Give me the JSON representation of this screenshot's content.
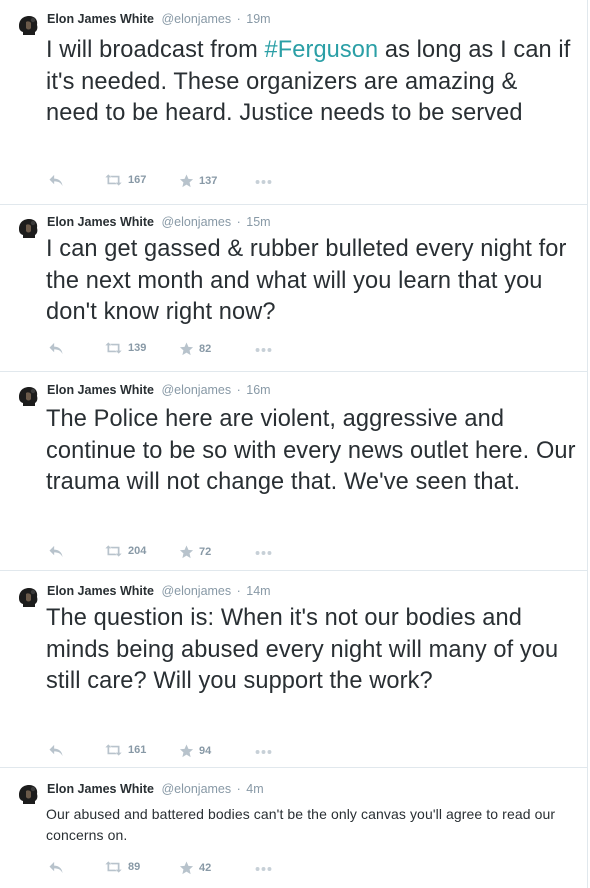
{
  "tweets": [
    {
      "name": "Elon James White",
      "handle": "@elonjames",
      "sep": "·",
      "time": "19m",
      "text_before": "I will broadcast from ",
      "hashtag": "#Ferguson",
      "text_after": " as long as I can if it's needed. These organizers are amazing & need to be heard. Justice needs to be served",
      "retweets": "167",
      "favorites": "137"
    },
    {
      "name": "Elon James White",
      "handle": "@elonjames",
      "sep": "·",
      "time": "15m",
      "text": "I can get gassed  & rubber bulleted every night for the next month and what will you learn that you don't know right now?",
      "retweets": "139",
      "favorites": "82"
    },
    {
      "name": "Elon James White",
      "handle": "@elonjames",
      "sep": "·",
      "time": "16m",
      "text": "The Police here are violent, aggressive and continue to be so with every news outlet here. Our trauma will not change that. We've seen that.",
      "retweets": "204",
      "favorites": "72"
    },
    {
      "name": "Elon James White",
      "handle": "@elonjames",
      "sep": "·",
      "time": "14m",
      "text": "The question is: When it's not our bodies and minds being abused every night will many of you still care? Will you support the work?",
      "retweets": "161",
      "favorites": "94"
    },
    {
      "name": "Elon James White",
      "handle": "@elonjames",
      "sep": "·",
      "time": "4m",
      "text": "Our abused and battered bodies can't be the only canvas you'll agree to read our concerns on.",
      "retweets": "89",
      "favorites": "42"
    }
  ],
  "icons": {
    "reply": "reply-icon",
    "retweet": "retweet-icon",
    "favorite": "star-icon",
    "more": "more-icon",
    "avatar": "avatar"
  },
  "colors": {
    "hashtag": "#2b9fa6",
    "meta": "#8899a6",
    "text": "#292f33",
    "border": "#e1e8ed"
  }
}
